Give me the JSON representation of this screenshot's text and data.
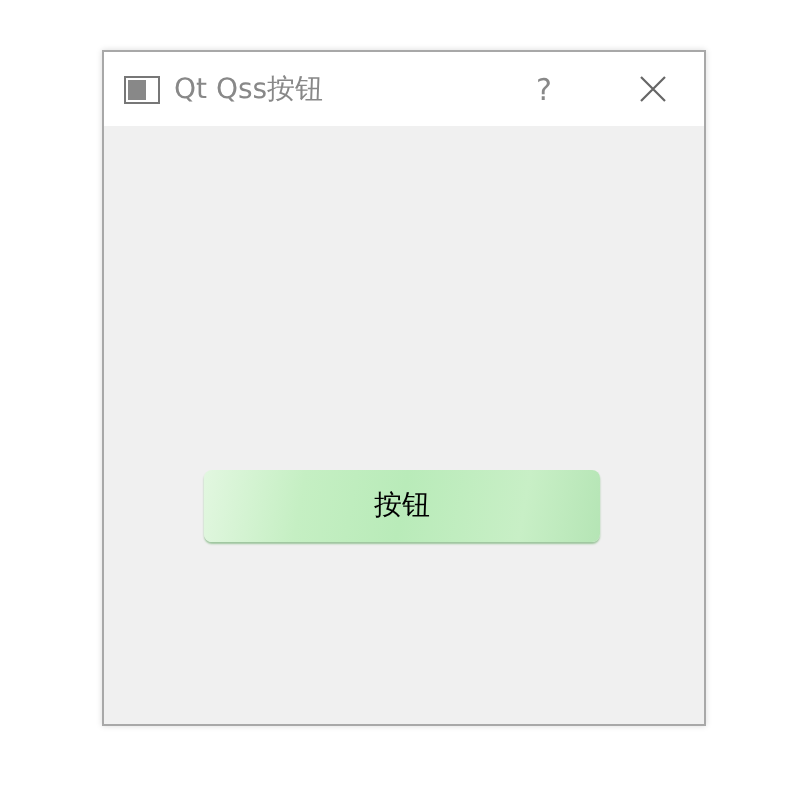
{
  "window": {
    "title": "Qt Qss按钮",
    "help": "?"
  },
  "button": {
    "label": "按钮"
  }
}
